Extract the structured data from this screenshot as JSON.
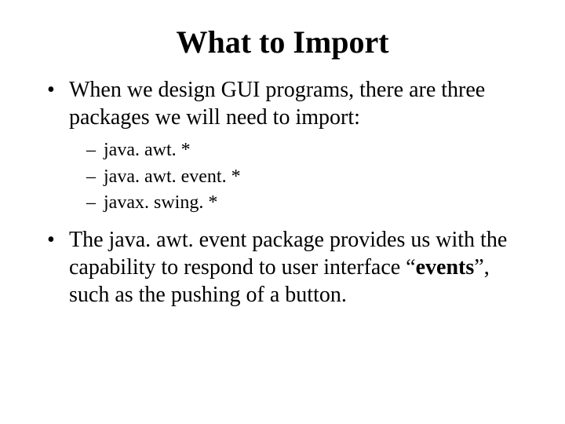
{
  "title": "What to Import",
  "bullets": {
    "b1": "When we design GUI programs, there are three packages we will need to import:",
    "sub": {
      "s1": "java. awt. *",
      "s2": "java. awt. event. *",
      "s3": "javax. swing. *"
    },
    "b2_pre": "The java. awt. event package provides us with the capability to respond to user interface “",
    "b2_bold": "events",
    "b2_post": "”, such as the pushing of a button."
  }
}
